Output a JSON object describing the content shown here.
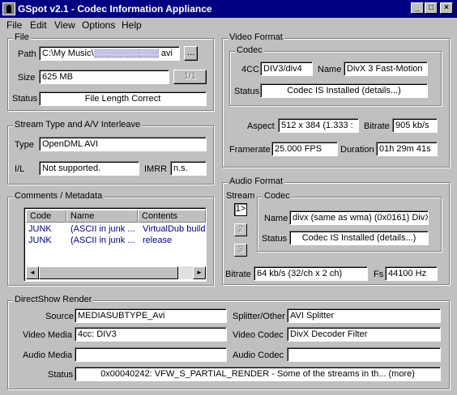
{
  "window": {
    "title": "GSpot v2.1 - Codec Information Appliance",
    "minimize": "_",
    "maximize": "□",
    "close": "×"
  },
  "menu": [
    "File",
    "Edit",
    "View",
    "Options",
    "Help"
  ],
  "file": {
    "group_label": "File",
    "path_label": "Path",
    "path_prefix": "C:\\My Music\\",
    "path_suffix": " avi",
    "browse_label": "...",
    "size_label": "Size",
    "size_value": "625 MB",
    "page_label": "1/1",
    "status_label": "Status",
    "status_value": "File Length Correct"
  },
  "stream": {
    "group_label": "Stream Type and A/V Interleave",
    "type_label": "Type",
    "type_value": "OpenDML AVI",
    "il_label": "I/L",
    "il_value": "Not supported.",
    "imrr_label": "IMRR",
    "imrr_value": "n.s."
  },
  "comments": {
    "group_label": "Comments / Metadata",
    "columns": [
      "Code",
      "Name",
      "Contents"
    ],
    "rows": [
      [
        "JUNK",
        "(ASCII in junk ...",
        "VirtualDub build"
      ],
      [
        "JUNK",
        "(ASCII in junk ...",
        "release"
      ]
    ],
    "scroll_left": "◄",
    "scroll_right": "►"
  },
  "video": {
    "group_label": "Video Format",
    "codec_group_label": "Codec",
    "fourcc_label": "4CC",
    "fourcc_value": "DIV3/div4",
    "name_label": "Name",
    "name_value": "DivX 3 Fast-Motion",
    "status_label": "Status",
    "status_value": "Codec IS Installed  (details...)",
    "aspect_label": "Aspect",
    "aspect_value": "512 x 384  (1.333 :",
    "bitrate_label": "Bitrate",
    "bitrate_value": "905 kb/s",
    "framerate_label": "Framerate",
    "framerate_value": "25.000 FPS",
    "duration_label": "Duration",
    "duration_value": "01h 29m 41s"
  },
  "audio": {
    "group_label": "Audio Format",
    "stream_label": "Stream",
    "streams": [
      "1>",
      "2",
      "3"
    ],
    "codec_group_label": "Codec",
    "name_label": "Name",
    "name_value": "divx (same as wma) (0x0161) DivX",
    "status_label": "Status",
    "status_value": "Codec IS Installed  (details...)",
    "bitrate_label": "Bitrate",
    "bitrate_value": "64 kb/s (32/ch x 2 ch)",
    "fs_label": "Fs",
    "fs_value": "44100 Hz"
  },
  "directshow": {
    "group_label": "DirectShow Render",
    "source_label": "Source",
    "source_value": "MEDIASUBTYPE_Avi",
    "splitter_label": "Splitter/Other",
    "splitter_value": "AVI Splitter",
    "video_media_label": "Video Media",
    "video_media_value": "4cc: DIV3",
    "video_codec_label": "Video Codec",
    "video_codec_value": "DivX Decoder Filter",
    "audio_media_label": "Audio Media",
    "audio_media_value": "",
    "audio_codec_label": "Audio Codec",
    "audio_codec_value": "",
    "status_label": "Status",
    "status_value": "0x00040242: VFW_S_PARTIAL_RENDER - Some of the streams in th...   (more)"
  }
}
